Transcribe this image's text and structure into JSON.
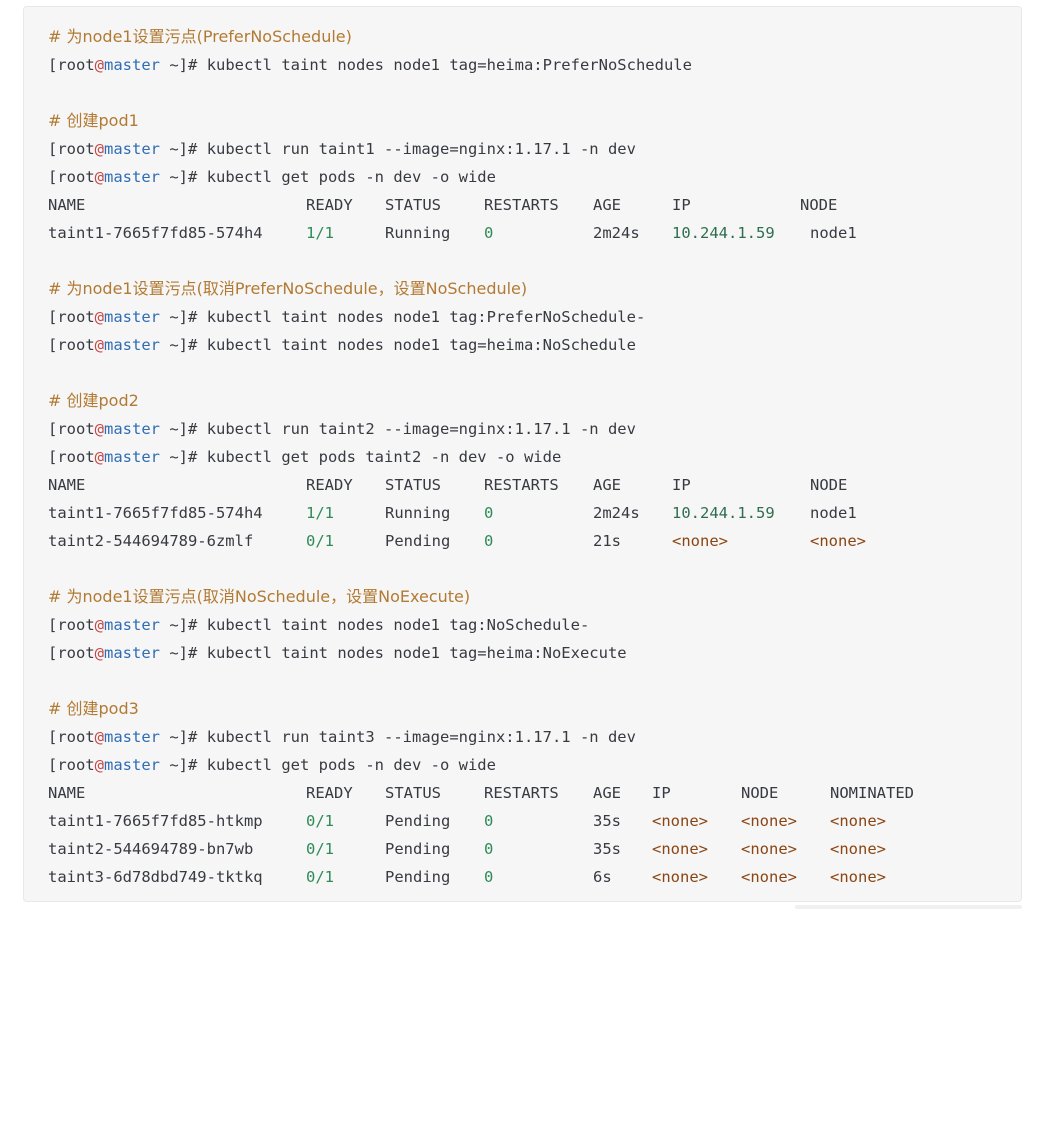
{
  "comments": {
    "c1": "# 为node1设置污点(PreferNoSchedule)",
    "c2": "# 创建pod1",
    "c3": "# 为node1设置污点(取消PreferNoSchedule，设置NoSchedule)",
    "c4": "# 创建pod2",
    "c5": "# 为node1设置污点(取消NoSchedule，设置NoExecute)",
    "c6": "# 创建pod3"
  },
  "prompt": {
    "open": "[root",
    "at": "@",
    "host": "master",
    "close": " ~]# "
  },
  "commands": {
    "cmd1": "kubectl taint nodes node1 tag=heima:PreferNoSchedule",
    "cmd2": "kubectl run taint1 --image=nginx:1.17.1 -n dev",
    "cmd3": "kubectl get pods -n dev -o wide",
    "cmd4": "kubectl taint nodes node1 tag:PreferNoSchedule-",
    "cmd5": "kubectl taint nodes node1 tag=heima:NoSchedule",
    "cmd6": "kubectl run taint2 --image=nginx:1.17.1 -n dev",
    "cmd7": "kubectl get pods taint2 -n dev -o wide",
    "cmd8": "kubectl taint nodes node1 tag:NoSchedule-",
    "cmd9": "kubectl taint nodes node1 tag=heima:NoExecute",
    "cmd10": "kubectl run taint3 --image=nginx:1.17.1 -n dev",
    "cmd11": "kubectl get pods -n dev -o wide"
  },
  "table1": {
    "headers": [
      "NAME",
      "READY",
      "STATUS",
      "RESTARTS",
      "AGE",
      "IP",
      "NODE"
    ],
    "rows": [
      [
        "taint1-7665f7fd85-574h4",
        "1/1",
        "Running",
        "0",
        "2m24s",
        "10.244.1.59",
        "node1"
      ]
    ]
  },
  "table2": {
    "headers": [
      "NAME",
      "READY",
      "STATUS",
      "RESTARTS",
      "AGE",
      "IP",
      "NODE"
    ],
    "rows": [
      [
        "taint1-7665f7fd85-574h4",
        "1/1",
        "Running",
        "0",
        "2m24s",
        "10.244.1.59",
        "node1"
      ],
      [
        "taint2-544694789-6zmlf",
        "0/1",
        "Pending",
        "0",
        "21s",
        "<none>",
        "<none>"
      ]
    ]
  },
  "table3": {
    "headers": [
      "NAME",
      "READY",
      "STATUS",
      "RESTARTS",
      "AGE",
      "IP",
      "NODE",
      "NOMINATED"
    ],
    "rows": [
      [
        "taint1-7665f7fd85-htkmp",
        "0/1",
        "Pending",
        "0",
        "35s",
        "<none>",
        "<none>",
        "<none>"
      ],
      [
        "taint2-544694789-bn7wb",
        "0/1",
        "Pending",
        "0",
        "35s",
        "<none>",
        "<none>",
        "<none>"
      ],
      [
        "taint3-6d78dbd749-tktkq",
        "0/1",
        "Pending",
        "0",
        "6s",
        "<none>",
        "<none>",
        "<none>"
      ]
    ]
  }
}
